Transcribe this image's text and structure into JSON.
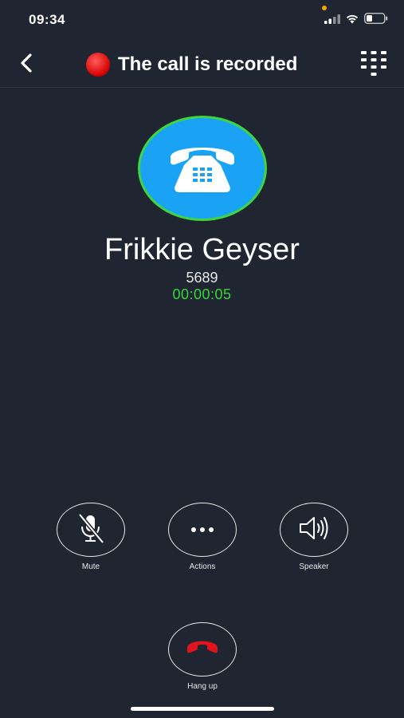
{
  "status_bar": {
    "time": "09:34",
    "icons": [
      "signal-icon",
      "wifi-icon",
      "battery-icon"
    ]
  },
  "header": {
    "title": "The call is recorded",
    "back_icon": "chevron-left-icon",
    "recording_icon": "red-circle-icon",
    "keypad_icon": "dialpad-icon"
  },
  "caller": {
    "name": "Frikkie Geyser",
    "number": "5689",
    "duration": "00:00:05",
    "avatar_icon": "telephone-icon"
  },
  "controls": {
    "mute_label": "Mute",
    "actions_label": "Actions",
    "speaker_label": "Speaker",
    "hangup_label": "Hang up"
  },
  "colors": {
    "background": "#1f2631",
    "avatar_fill": "#1aa3f5",
    "avatar_ring": "#3ed63e",
    "timer": "#36d63b",
    "recording": "#d40000",
    "hangup": "#e0141e"
  }
}
